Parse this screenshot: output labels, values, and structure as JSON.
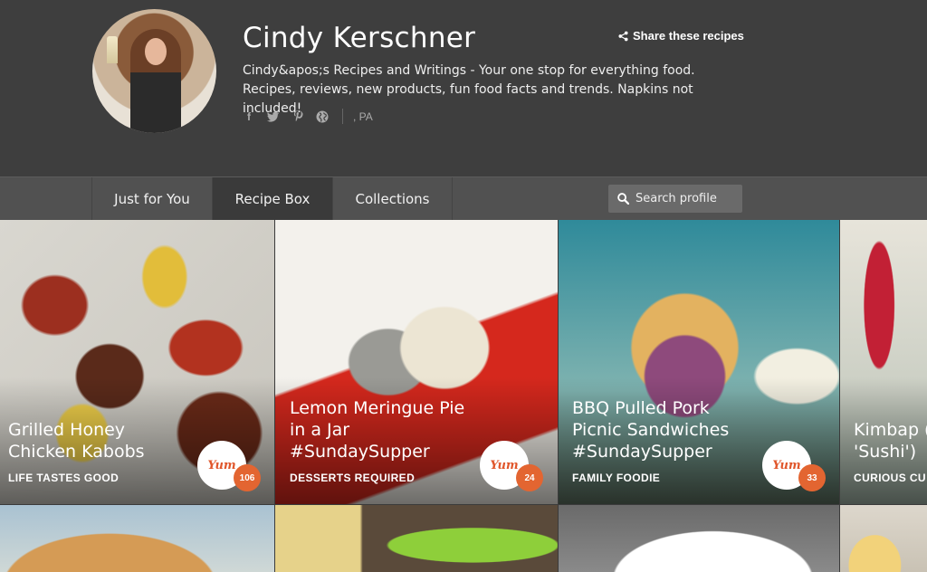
{
  "profile": {
    "name": "Cindy Kerschner",
    "share_label": "Share these recipes",
    "bio": "Cindy&apos;s Recipes and Writings - Your one stop for everything food. Recipes, reviews, new products, fun food facts and trends. Napkins not included!",
    "location": ", PA",
    "social_icons": [
      "facebook-icon",
      "twitter-icon",
      "pinterest-icon",
      "globe-icon"
    ]
  },
  "nav": {
    "tabs": [
      {
        "label": "Just for You",
        "active": false
      },
      {
        "label": "Recipe Box",
        "active": true
      },
      {
        "label": "Collections",
        "active": false
      }
    ],
    "search_placeholder": "Search profile"
  },
  "cards": [
    {
      "title_line1": "Grilled Honey",
      "title_line2": "Chicken Kabobs",
      "title_line3": "",
      "author": "LIFE TASTES GOOD",
      "yum_label": "Yum",
      "yum_count": "106"
    },
    {
      "title_line1": "Lemon Meringue Pie",
      "title_line2": "in a Jar",
      "title_line3": "#SundaySupper",
      "author": "DESSERTS REQUIRED",
      "yum_label": "Yum",
      "yum_count": "24"
    },
    {
      "title_line1": "BBQ Pulled Pork",
      "title_line2": "Picnic Sandwiches",
      "title_line3": "#SundaySupper",
      "author": "FAMILY FOODIE",
      "yum_label": "Yum",
      "yum_count": "33"
    },
    {
      "title_line1": "Kimbap (",
      "title_line2": "'Sushi')",
      "title_line3": "",
      "author": "CURIOUS CU",
      "yum_label": "",
      "yum_count": ""
    }
  ],
  "colors": {
    "header_bg": "#3e3e3e",
    "nav_bg": "#515151",
    "active_tab_bg": "#3a3a3a",
    "yum_accent": "#e36531"
  }
}
